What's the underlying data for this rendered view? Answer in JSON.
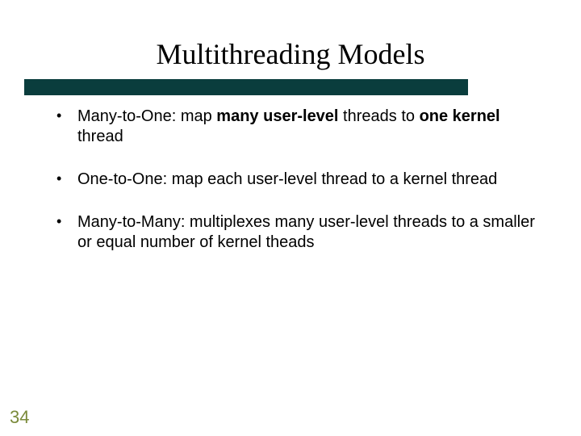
{
  "title": "Multithreading Models",
  "bullets": [
    {
      "prefix": "Many-to-One: map ",
      "bold1": "many user-level",
      "mid": " threads to ",
      "bold2": "one kernel",
      "suffix": " thread"
    },
    {
      "text": "One-to-One: map each user-level thread to a kernel thread"
    },
    {
      "text": "Many-to-Many: multiplexes many user-level threads to a smaller or equal number of kernel theads"
    }
  ],
  "page_number": "34"
}
